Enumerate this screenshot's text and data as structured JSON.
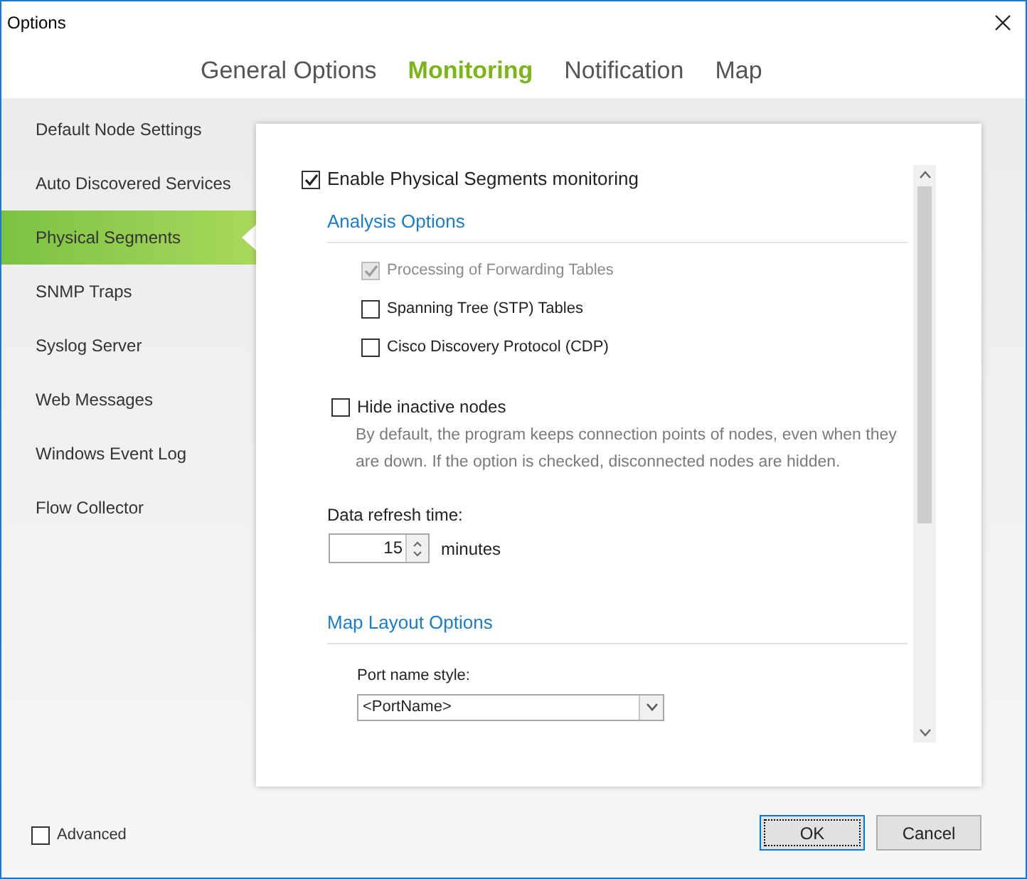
{
  "window": {
    "title": "Options"
  },
  "tabs": [
    {
      "label": "General Options",
      "selected": false
    },
    {
      "label": "Monitoring",
      "selected": true
    },
    {
      "label": "Notification",
      "selected": false
    },
    {
      "label": "Map",
      "selected": false
    }
  ],
  "sidebar": {
    "items": [
      {
        "label": "Default Node Settings",
        "selected": false
      },
      {
        "label": "Auto Discovered Services",
        "selected": false
      },
      {
        "label": "Physical Segments",
        "selected": true
      },
      {
        "label": "SNMP Traps",
        "selected": false
      },
      {
        "label": "Syslog Server",
        "selected": false
      },
      {
        "label": "Web Messages",
        "selected": false
      },
      {
        "label": "Windows Event Log",
        "selected": false
      },
      {
        "label": "Flow Collector",
        "selected": false
      }
    ]
  },
  "monitoring": {
    "label": "Enable Physical Segments monitoring",
    "checked": true
  },
  "analysis_options": {
    "heading": "Analysis Options",
    "options": [
      {
        "label": "Processing of Forwarding Tables",
        "checked": true,
        "disabled": true
      },
      {
        "label": "Spanning Tree (STP) Tables",
        "checked": false,
        "disabled": false
      },
      {
        "label": "Cisco Discovery Protocol (CDP)",
        "checked": false,
        "disabled": false
      }
    ]
  },
  "hide_inactive": {
    "label": "Hide inactive nodes",
    "checked": false,
    "description": "By default, the program keeps connection points of nodes, even when they are down. If the option is checked, disconnected nodes are hidden."
  },
  "data_refresh": {
    "label": "Data refresh time:",
    "value": "15",
    "unit": "minutes"
  },
  "map_layout_options": {
    "heading": "Map Layout Options",
    "port_name_style": {
      "label": "Port name style:",
      "value": "<PortName>"
    }
  },
  "advanced": {
    "label": "Advanced",
    "checked": false
  },
  "buttons": [
    {
      "label": "OK",
      "default": true
    },
    {
      "label": "Cancel",
      "default": false
    }
  ]
}
